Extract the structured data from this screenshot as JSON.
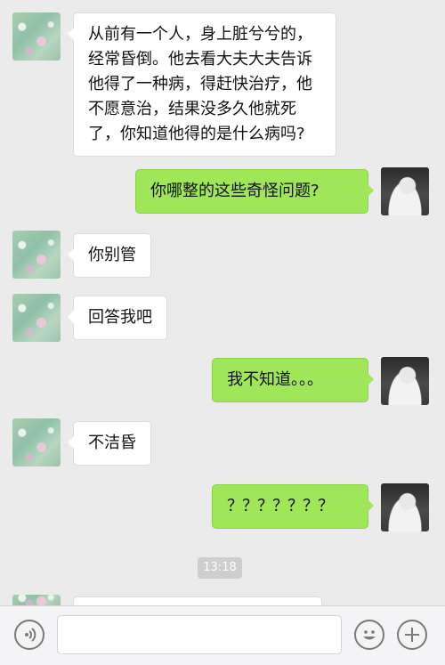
{
  "messages": [
    {
      "side": "left",
      "text": "从前有一个人，身上脏兮兮的，经常昏倒。他去看大夫大夫告诉他得了一种病，得赶快治疗，他不愿意治，结果没多久他就死了，你知道他得的是什么病吗?"
    },
    {
      "side": "right",
      "text": "你哪整的这些奇怪问题?"
    },
    {
      "side": "left",
      "text": "你别管"
    },
    {
      "side": "left",
      "text": "回答我吧"
    },
    {
      "side": "right",
      "text": "我不知道。。。"
    },
    {
      "side": "left",
      "text": "不洁昏"
    },
    {
      "side": "right",
      "text": "？？？？？？？"
    }
  ],
  "timestamp": "13:18",
  "input": {
    "placeholder": ""
  },
  "icons": {
    "voice": "voice-icon",
    "emoji": "emoji-icon",
    "add": "plus-icon"
  },
  "colors": {
    "background": "#ebebeb",
    "outgoing_bubble": "#9fe658",
    "incoming_bubble": "#ffffff"
  }
}
